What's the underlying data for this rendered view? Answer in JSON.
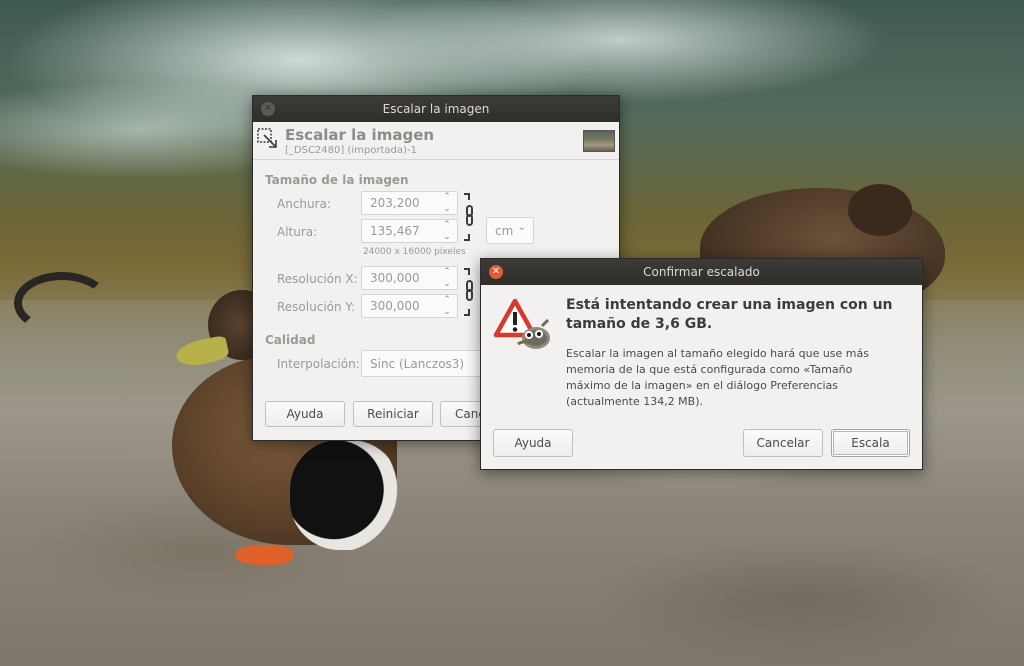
{
  "scale_dialog": {
    "title": "Escalar la imagen",
    "heading": "Escalar la imagen",
    "subheading": "[_DSC2480] (importada)-1",
    "section_size": "Tamaño de la imagen",
    "width_label": "Anchura:",
    "width_value": "203,200",
    "height_label": "Altura:",
    "height_value": "135,467",
    "unit": "cm",
    "pixel_size": "24000 x 16000 píxeles",
    "res_x_label": "Resolución X:",
    "res_x_value": "300,000",
    "res_y_label": "Resolución Y:",
    "res_y_value": "300,000",
    "section_quality": "Calidad",
    "interp_label": "Interpolación:",
    "interp_value": "Sinc (Lanczos3)",
    "help_button": "Ayuda",
    "reset_button": "Reiniciar",
    "cancel_button": "Canc"
  },
  "confirm_dialog": {
    "title": "Confirmar escalado",
    "heading": "Está intentando crear una imagen con un tamaño de 3,6 GB.",
    "message": "Escalar la imagen al tamaño elegido hará que use más memoria de la que está configurada como «Tamaño máximo de la imagen» en el diálogo Preferencias (actualmente 134,2 MB).",
    "help_button": "Ayuda",
    "cancel_button": "Cancelar",
    "scale_button": "Escala"
  },
  "icons": {
    "close": "close-icon",
    "scale_tool": "scale-tool-icon",
    "warning": "warning-icon",
    "gimp_mascot": "gimp-wilber-icon",
    "chain": "chain-icon",
    "thumbnail": "image-thumbnail"
  },
  "colors": {
    "titlebar": "#3c3b37",
    "close_active": "#e05a33",
    "warning_red": "#d9382e"
  }
}
